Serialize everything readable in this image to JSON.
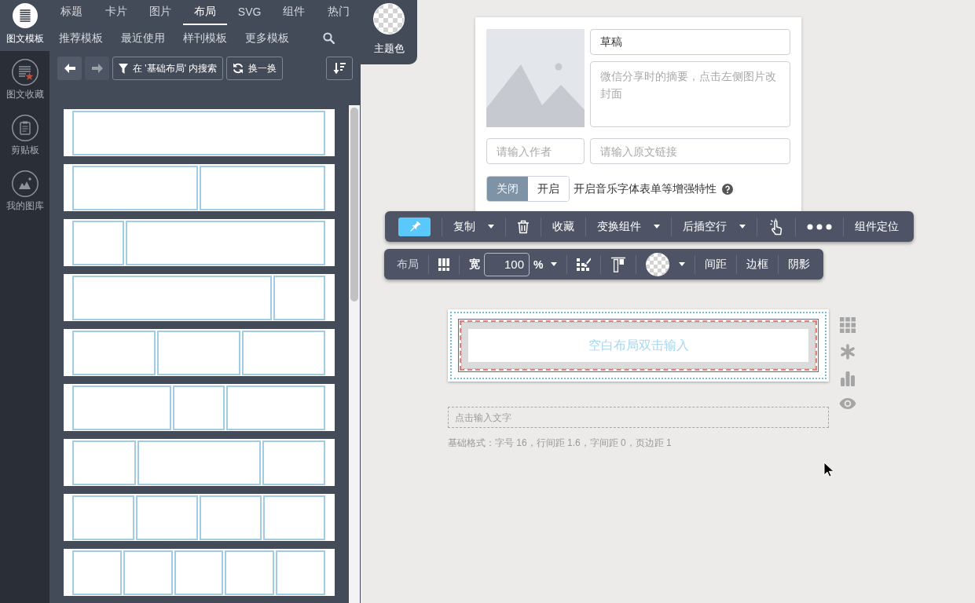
{
  "rail": {
    "items": [
      {
        "kind": "template",
        "label": "图文模板",
        "selected": true
      },
      {
        "kind": "favorites",
        "label": "图文收藏",
        "selected": false
      },
      {
        "kind": "clipboard",
        "label": "剪贴板",
        "selected": false
      },
      {
        "kind": "gallery",
        "label": "我的图库",
        "selected": false
      }
    ]
  },
  "category_tabs": [
    {
      "label": "标题",
      "selected": false
    },
    {
      "label": "卡片",
      "selected": false
    },
    {
      "label": "图片",
      "selected": false
    },
    {
      "label": "布局",
      "selected": true
    },
    {
      "label": "SVG",
      "selected": false
    },
    {
      "label": "组件",
      "selected": false
    },
    {
      "label": "热门",
      "selected": false
    }
  ],
  "template_tabs": [
    "推荐模板",
    "最近使用",
    "样刊模板",
    "更多模板"
  ],
  "theme_color": {
    "label": "主题色"
  },
  "panel_toolbar": {
    "nav_buttons": [
      {
        "kind": "back",
        "disabled": false
      },
      {
        "kind": "forward",
        "disabled": true
      }
    ],
    "filter_button": {
      "label": "在 '基础布局' 内搜索"
    },
    "shuffle_button": {
      "label": "换一换"
    }
  },
  "layout_templates": [
    {
      "cells": [
        {
          "kind": "wide"
        }
      ]
    },
    {
      "cells": [
        {
          "kind": "medium"
        },
        {
          "kind": "medium"
        }
      ]
    },
    {
      "cells": [
        {
          "kind": "narrow"
        },
        {
          "kind": "wide"
        }
      ]
    },
    {
      "cells": [
        {
          "kind": "wide"
        },
        {
          "kind": "narrow"
        }
      ]
    },
    {
      "cells": [
        {
          "kind": "medium"
        },
        {
          "kind": "medium"
        },
        {
          "kind": "medium"
        }
      ]
    },
    {
      "cells": [
        {
          "kind": "medium"
        },
        {
          "kind": "narrow"
        },
        {
          "kind": "medium"
        }
      ]
    },
    {
      "cells": [
        {
          "kind": "narrow"
        },
        {
          "kind": "medium"
        },
        {
          "kind": "narrow"
        }
      ]
    },
    {
      "cells": [
        {
          "kind": "medium"
        },
        {
          "kind": "medium"
        },
        {
          "kind": "medium"
        },
        {
          "kind": "medium"
        }
      ]
    },
    {
      "cells": [
        {
          "kind": "narrow"
        },
        {
          "kind": "narrow"
        },
        {
          "kind": "narrow"
        },
        {
          "kind": "narrow"
        },
        {
          "kind": "narrow"
        }
      ]
    }
  ],
  "article_form": {
    "title_field": {
      "value": "草稿"
    },
    "summary_field": {
      "placeholder": "微信分享时的摘要，点击左侧图片改封面"
    },
    "author_field": {
      "placeholder": "请输入作者"
    },
    "link_field": {
      "placeholder": "请输入原文链接"
    },
    "enhance_toggle": {
      "options": [
        {
          "label": "关闭",
          "selected": true
        },
        {
          "label": "开启",
          "selected": false
        }
      ],
      "label": "开启音乐字体表单等增强特性"
    }
  },
  "component_toolbar": {
    "items": [
      {
        "kind": "pin",
        "active": true
      },
      {
        "kind": "dropdown",
        "label": "复制"
      },
      {
        "kind": "trash"
      },
      {
        "kind": "button",
        "label": "收藏"
      },
      {
        "kind": "dropdown",
        "label": "变换组件"
      },
      {
        "kind": "dropdown",
        "label": "后插空行"
      },
      {
        "kind": "pointer"
      },
      {
        "kind": "more"
      },
      {
        "kind": "button",
        "label": "组件定位"
      }
    ]
  },
  "layout_toolbar": {
    "items": [
      {
        "kind": "label",
        "label": "布局"
      },
      {
        "kind": "columns"
      },
      {
        "kind": "width",
        "label": "宽",
        "value": "100",
        "unit": "%"
      },
      {
        "kind": "brush-grid"
      },
      {
        "kind": "align-top"
      },
      {
        "kind": "color"
      },
      {
        "kind": "button",
        "label": "间距"
      },
      {
        "kind": "button",
        "label": "边框"
      },
      {
        "kind": "button",
        "label": "阴影"
      }
    ]
  },
  "layout_block": {
    "text": "空白布局双击输入"
  },
  "text_input": {
    "placeholder": "点击输入文字"
  },
  "format_note": "基础格式：字号 16，行间距 1.6，字间距 0，页边距 1"
}
